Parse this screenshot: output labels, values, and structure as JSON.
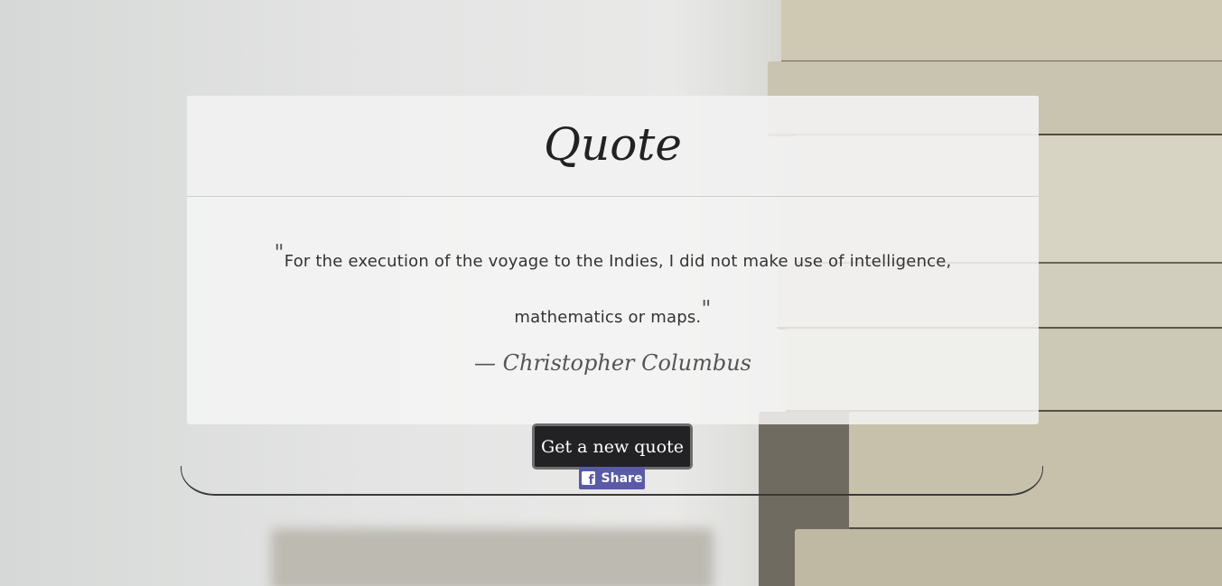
{
  "card": {
    "title": "Quote"
  },
  "quote": {
    "open_mark": "\"",
    "text": "For the execution of the voyage to the Indies, I did not make use of intelligence, mathematics or maps.",
    "close_mark": "\"",
    "author": "— Christopher Columbus"
  },
  "actions": {
    "new_quote_label": "Get a new quote",
    "share_label": "Share",
    "share_icon_glyph": "f"
  },
  "colors": {
    "button_bg": "#222224",
    "share_bg": "#5a5aa6"
  }
}
